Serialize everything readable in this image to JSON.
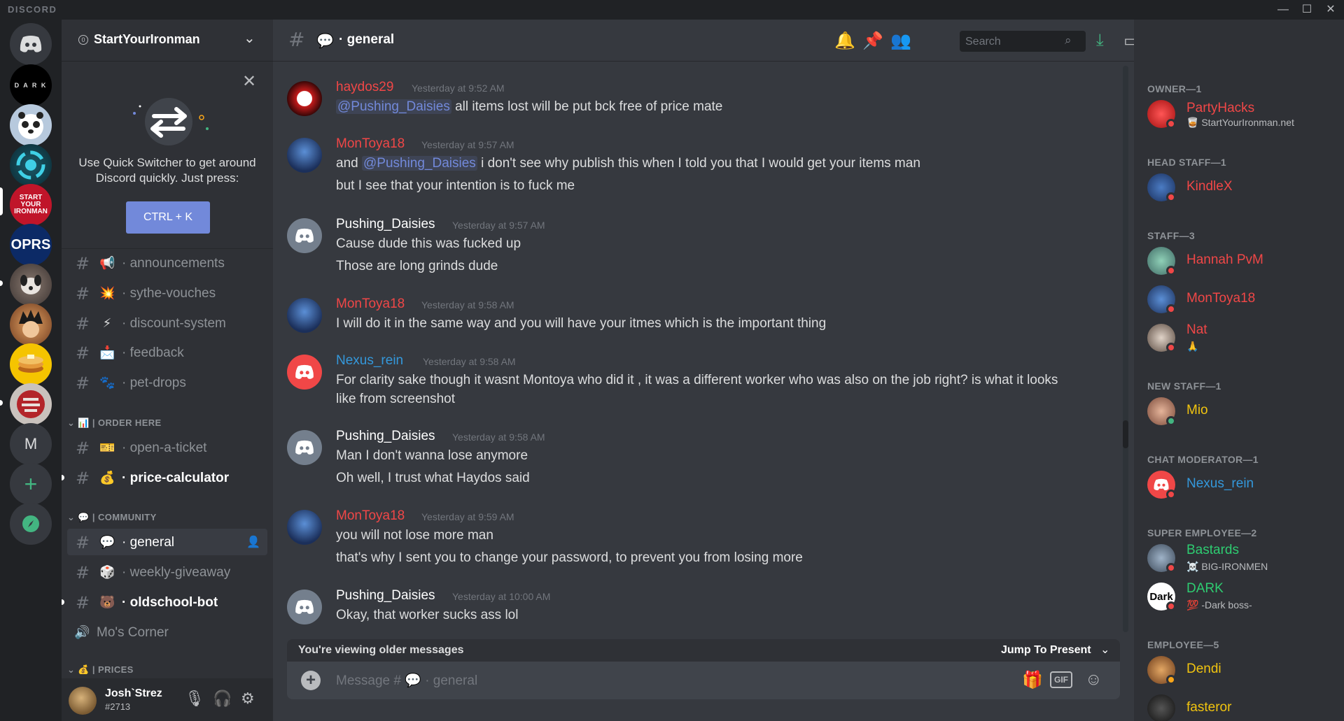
{
  "titlebar": {
    "brand": "DISCORD",
    "minimize": "—",
    "maximize": "☐",
    "close": "✕"
  },
  "rail": {
    "dark_text": "D A R K",
    "syi_text": "START YOUR IRONMAN",
    "osrs_text": "OPRS",
    "m_letter": "M",
    "add": "+",
    "explore": "⌖"
  },
  "guild": {
    "name": "StartYourIronman",
    "badge": "0",
    "chevron": "⌄"
  },
  "quick_switcher": {
    "close": "✕",
    "text": "Use Quick Switcher to get around Discord quickly. Just press:",
    "button": "CTRL + K"
  },
  "channels": [
    {
      "emoji": "📢",
      "label": "· announcements"
    },
    {
      "emoji": "💥",
      "label": "· sythe-vouches"
    },
    {
      "emoji": "⚡",
      "label": "· discount-system"
    },
    {
      "emoji": "📩",
      "label": "· feedback"
    },
    {
      "emoji": "🐾",
      "label": "· pet-drops"
    },
    {
      "emoji": "🎫",
      "label": "· open-a-ticket"
    },
    {
      "emoji": "💰",
      "label": "· price-calculator"
    },
    {
      "emoji": "💬",
      "label": "· general"
    },
    {
      "emoji": "🎲",
      "label": "· weekly-giveaway"
    },
    {
      "emoji": "🐻",
      "label": "· oldschool-bot"
    },
    {
      "emoji": "🔊",
      "label": "Mo's Corner"
    }
  ],
  "categories": {
    "order_here": "⌄ 📊 | ORDER HERE",
    "community": "⌄ 💬 | COMMUNITY",
    "prices": "⌄ 💰 | PRICES"
  },
  "user": {
    "name": "Josh`Strez",
    "tag": "#2713"
  },
  "chat": {
    "channel": "general",
    "channel_emoji": "💬",
    "search_placeholder": "Search",
    "messages": [
      {
        "author": "haydos29",
        "color": "#f04747",
        "time": "Yesterday at 9:52 AM",
        "lines": [
          {
            "mention": "@Pushing_Daisies",
            "text": " all items lost will be put bck free of price mate"
          }
        ]
      },
      {
        "author": "MonToya18",
        "color": "#f04747",
        "time": "Yesterday at 9:57 AM",
        "lines": [
          {
            "pre": "and ",
            "mention": "@Pushing_Daisies",
            "text": " i don't see why publish this when I told you that I would get your items man"
          },
          {
            "text": "but I see that your intention is to fuck me"
          }
        ]
      },
      {
        "author": "Pushing_Daisies",
        "color": "#ffffff",
        "time": "Yesterday at 9:57 AM",
        "lines": [
          {
            "text": "Cause dude this was fucked up"
          },
          {
            "text": "Those are long grinds dude"
          }
        ]
      },
      {
        "author": "MonToya18",
        "color": "#f04747",
        "time": "Yesterday at 9:58 AM",
        "lines": [
          {
            "text": "I will do it in the same way and you will have your itmes which is the important thing"
          }
        ]
      },
      {
        "author": "Nexus_rein",
        "color": "#3498db",
        "time": "Yesterday at 9:58 AM",
        "lines": [
          {
            "text": "For clarity sake though it wasnt Montoya who did it , it was a different worker who was also on the job right? is what it looks"
          },
          {
            "text": "like from screenshot"
          }
        ]
      },
      {
        "author": "Pushing_Daisies",
        "color": "#ffffff",
        "time": "Yesterday at 9:58 AM",
        "lines": [
          {
            "text": "Man I don't wanna lose anymore"
          },
          {
            "text": "Oh well, I trust what Haydos said"
          }
        ]
      },
      {
        "author": "MonToya18",
        "color": "#f04747",
        "time": "Yesterday at 9:59 AM",
        "lines": [
          {
            "text": "you will not lose more man"
          },
          {
            "text": "that's why I sent you to change your password, to prevent you from losing more"
          }
        ]
      },
      {
        "author": "Pushing_Daisies",
        "color": "#ffffff",
        "time": "Yesterday at 10:00 AM",
        "lines": [
          {
            "text": "Okay, that worker sucks ass lol"
          }
        ]
      }
    ],
    "older_notice": "You're viewing older messages",
    "jump": "Jump To Present",
    "composer_prefix": "Message #",
    "composer_channel": "· general"
  },
  "members": {
    "roles": [
      {
        "name": "OWNER—1"
      },
      {
        "name": "HEAD STAFF—1"
      },
      {
        "name": "STAFF—3"
      },
      {
        "name": "NEW STAFF—1"
      },
      {
        "name": "CHAT MODERATOR—1"
      },
      {
        "name": "SUPER EMPLOYEE—2"
      },
      {
        "name": "EMPLOYEE—5"
      }
    ],
    "list": [
      {
        "name": "PartyHacks",
        "sub": "🥃 StartYourIronman.net",
        "color": "#f04747"
      },
      {
        "name": "KindleX",
        "color": "#f04747"
      },
      {
        "name": "Hannah PvM",
        "color": "#f04747"
      },
      {
        "name": "MonToya18",
        "color": "#f04747"
      },
      {
        "name": "Nat",
        "sub": "🙏",
        "color": "#f04747"
      },
      {
        "name": "Mio",
        "color": "#f1c40f"
      },
      {
        "name": "Nexus_rein",
        "color": "#3498db"
      },
      {
        "name": "Bastards",
        "sub": "☠️ BIG-IRONMEN",
        "color": "#2ecc71"
      },
      {
        "name": "DARK",
        "sub": "💯 -Dark boss-",
        "color": "#2ecc71",
        "avatar_text": "Dark"
      },
      {
        "name": "Dendi",
        "color": "#f1c40f"
      },
      {
        "name": "fasteror",
        "color": "#f1c40f"
      }
    ]
  },
  "colors": {
    "accent": "#7289da",
    "dnd": "#f04747",
    "online": "#43b581",
    "idle": "#faa61a"
  }
}
